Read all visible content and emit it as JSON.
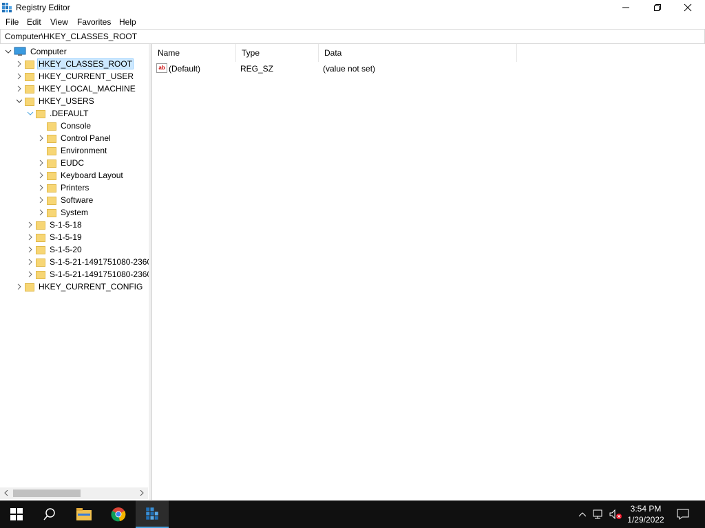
{
  "window": {
    "title": "Registry Editor"
  },
  "menu": [
    "File",
    "Edit",
    "View",
    "Favorites",
    "Help"
  ],
  "address": "Computer\\HKEY_CLASSES_ROOT",
  "tree": {
    "root": "Computer",
    "hives": {
      "classes_root": "HKEY_CLASSES_ROOT",
      "current_user": "HKEY_CURRENT_USER",
      "local_machine": "HKEY_LOCAL_MACHINE",
      "users": "HKEY_USERS",
      "current_config": "HKEY_CURRENT_CONFIG"
    },
    "users_children": {
      "default": ".DEFAULT",
      "default_children": [
        "Console",
        "Control Panel",
        "Environment",
        "EUDC",
        "Keyboard Layout",
        "Printers",
        "Software",
        "System"
      ],
      "sids": [
        "S-1-5-18",
        "S-1-5-19",
        "S-1-5-20",
        "S-1-5-21-1491751080-2360",
        "S-1-5-21-1491751080-2360"
      ]
    }
  },
  "columns": {
    "name": "Name",
    "type": "Type",
    "data": "Data"
  },
  "values": [
    {
      "name": "(Default)",
      "type": "REG_SZ",
      "data": "(value not set)",
      "icon": "string-value-icon"
    }
  ],
  "taskbar": {
    "apps": [
      "start-icon",
      "search-icon",
      "file-explorer-icon",
      "chrome-icon",
      "registry-editor-icon"
    ],
    "clock_time": "3:54 PM",
    "clock_date": "1/29/2022"
  },
  "colors": {
    "selection": "#cce8ff",
    "taskbar": "#101010",
    "folder": "#f7d675",
    "accent": "#4aa3df"
  }
}
